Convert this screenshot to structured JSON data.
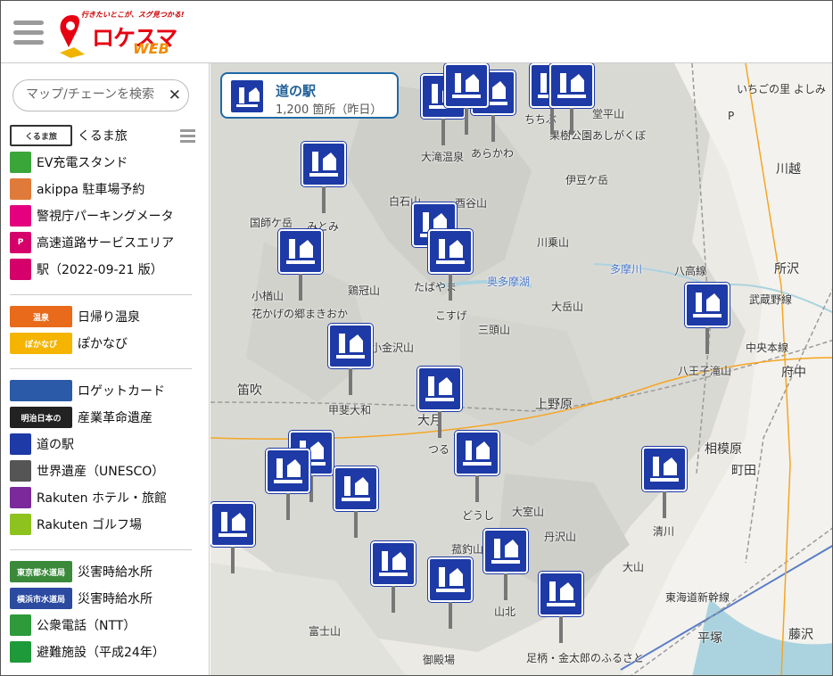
{
  "header": {
    "tagline": "行きたいとこが、スグ見つかる!",
    "brand": "ロケスマ",
    "brand_sub": "WEB"
  },
  "search": {
    "placeholder": "マップ/チェーンを検索",
    "clear": "✕"
  },
  "sidebar": {
    "group1": [
      {
        "label": "くるま旅",
        "icon": "kurumatabi-logo-icon",
        "icon_text": "くるま旅",
        "color": "#ffffff"
      },
      {
        "label": "EV充電スタンド",
        "icon": "ev-charger-icon",
        "icon_text": "",
        "color": "#3aa63a"
      },
      {
        "label": "akippa 駐車場予約",
        "icon": "akippa-icon",
        "icon_text": "",
        "color": "#e07a3a"
      },
      {
        "label": "警視庁パーキングメータ",
        "icon": "parking-meter-icon",
        "icon_text": "",
        "color": "#e4007f"
      },
      {
        "label": "高速道路サービスエリア",
        "icon": "service-area-icon",
        "icon_text": "P",
        "color": "#d6006a"
      },
      {
        "label": "駅（2022-09-21 版）",
        "icon": "train-station-icon",
        "icon_text": "",
        "color": "#d6006a"
      }
    ],
    "group2": [
      {
        "label": "日帰り温泉",
        "icon": "onsen-logo-icon",
        "icon_text": "温泉",
        "color": "#e86a1a"
      },
      {
        "label": "ぽかなび",
        "icon": "pokanavi-logo-icon",
        "icon_text": "ぽかなび",
        "color": "#f5b400"
      }
    ],
    "group3": [
      {
        "label": "ロゲットカード",
        "icon": "logetcard-logo-icon",
        "icon_text": "",
        "color": "#2b5aa8"
      },
      {
        "label": "産業革命遺産",
        "icon": "industrial-heritage-icon",
        "icon_text": "明治日本の",
        "color": "#222222"
      },
      {
        "label": "道の駅",
        "icon": "michinoeki-icon",
        "icon_text": "",
        "color": "#1d3aa6"
      },
      {
        "label": "世界遺産（UNESCO）",
        "icon": "world-heritage-icon",
        "icon_text": "",
        "color": "#555555"
      },
      {
        "label": "Rakuten ホテル・旅館",
        "icon": "rakuten-hotel-icon",
        "icon_text": "",
        "color": "#7a2a9a"
      },
      {
        "label": "Rakuten ゴルフ場",
        "icon": "rakuten-golf-icon",
        "icon_text": "",
        "color": "#8dc21f"
      }
    ],
    "group4": [
      {
        "label": "災害時給水所",
        "icon": "tokyo-water-icon",
        "icon_text": "東京都水道局",
        "color": "#3a8a3a"
      },
      {
        "label": "災害時給水所",
        "icon": "yokohama-water-icon",
        "icon_text": "横浜市水道局",
        "color": "#2b4aa0"
      },
      {
        "label": "公衆電話（NTT）",
        "icon": "public-phone-icon",
        "icon_text": "",
        "color": "#2e9a3a"
      },
      {
        "label": "避難施設（平成24年）",
        "icon": "evacuation-icon",
        "icon_text": "",
        "color": "#1f9a3a"
      }
    ]
  },
  "layer": {
    "title": "道の駅",
    "count": "1,200 箇所（昨日）"
  },
  "map": {
    "places": [
      {
        "name": "いちごの里 よしみ",
        "cls": ""
      },
      {
        "name": "P",
        "cls": ""
      },
      {
        "name": "ちちぶ",
        "cls": ""
      },
      {
        "name": "堂平山",
        "cls": ""
      },
      {
        "name": "果樹公園あしがくぼ",
        "cls": ""
      },
      {
        "name": "大滝温泉",
        "cls": ""
      },
      {
        "name": "あらかわ",
        "cls": ""
      },
      {
        "name": "川越",
        "cls": "large"
      },
      {
        "name": "伊豆ケ岳",
        "cls": ""
      },
      {
        "name": "白石山",
        "cls": ""
      },
      {
        "name": "酉谷山",
        "cls": ""
      },
      {
        "name": "みとみ",
        "cls": ""
      },
      {
        "name": "国師ケ岳",
        "cls": ""
      },
      {
        "name": "川乗山",
        "cls": ""
      },
      {
        "name": "八高線",
        "cls": ""
      },
      {
        "name": "所沢",
        "cls": "large"
      },
      {
        "name": "多摩川",
        "cls": "blue"
      },
      {
        "name": "奥多摩湖",
        "cls": "blue"
      },
      {
        "name": "小楢山",
        "cls": ""
      },
      {
        "name": "鶏冠山",
        "cls": ""
      },
      {
        "name": "たばやま",
        "cls": ""
      },
      {
        "name": "大岳山",
        "cls": ""
      },
      {
        "name": "武蔵野線",
        "cls": ""
      },
      {
        "name": "花かげの郷まきおか",
        "cls": ""
      },
      {
        "name": "こすげ",
        "cls": ""
      },
      {
        "name": "三頭山",
        "cls": ""
      },
      {
        "name": "小金沢山",
        "cls": ""
      },
      {
        "name": "中央本線",
        "cls": ""
      },
      {
        "name": "八王子滝山",
        "cls": ""
      },
      {
        "name": "府中",
        "cls": "large"
      },
      {
        "name": "笛吹",
        "cls": "large"
      },
      {
        "name": "上野原",
        "cls": "large"
      },
      {
        "name": "甲斐大和",
        "cls": ""
      },
      {
        "name": "大月",
        "cls": "large"
      },
      {
        "name": "相模原",
        "cls": "large"
      },
      {
        "name": "つる",
        "cls": ""
      },
      {
        "name": "町田",
        "cls": "large"
      },
      {
        "name": "大室山",
        "cls": ""
      },
      {
        "name": "どうし",
        "cls": ""
      },
      {
        "name": "清川",
        "cls": ""
      },
      {
        "name": "丹沢山",
        "cls": ""
      },
      {
        "name": "菰釣山",
        "cls": ""
      },
      {
        "name": "大山",
        "cls": ""
      },
      {
        "name": "山北",
        "cls": ""
      },
      {
        "name": "東海道新幹線",
        "cls": ""
      },
      {
        "name": "富士山",
        "cls": ""
      },
      {
        "name": "平塚",
        "cls": "large"
      },
      {
        "name": "藤沢",
        "cls": "large"
      },
      {
        "name": "御殿場",
        "cls": ""
      },
      {
        "name": "足柄・金太郎のふるさと",
        "cls": ""
      }
    ],
    "marker_count": 24
  }
}
